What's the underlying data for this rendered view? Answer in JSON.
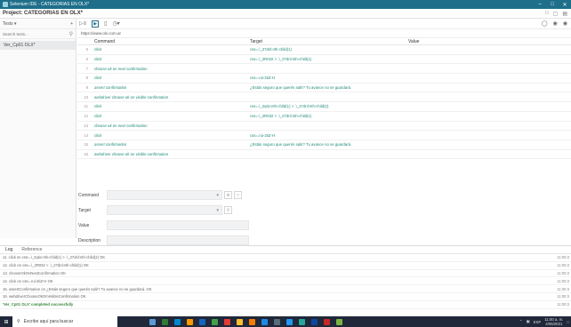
{
  "window": {
    "title": "Selenium IDE - CATEGORIAS EN OLX*"
  },
  "project": {
    "label": "Project:  CATEGORIAS EN OLX*"
  },
  "tests_panel": {
    "header": "Tests",
    "search_placeholder": "Search tests...",
    "items": [
      {
        "label": "Ver_Cp01 OLX*"
      }
    ]
  },
  "url": "https://www.olx.com.ar",
  "table": {
    "headers": {
      "command": "Command",
      "target": "Target",
      "value": "Value"
    },
    "rows": [
      {
        "num": "5",
        "command": "click",
        "target": "css=.\\_27dnl:nth-child(1)",
        "value": ""
      },
      {
        "num": "6",
        "command": "click",
        "target": "css=.\\_2R032 > .\\_27dnl:nth-child(1)",
        "value": ""
      },
      {
        "num": "7",
        "command": "choose ok on next confirmation",
        "target": "",
        "value": ""
      },
      {
        "num": "8",
        "command": "click",
        "target": "css=.rui-2tiZ-H",
        "value": ""
      },
      {
        "num": "9",
        "command": "assert confirmation",
        "target": "¿Estás seguro que querés salir? Tu avance no se guardará.",
        "value": ""
      },
      {
        "num": "10",
        "command": "webdriver choose ok on visible confirmation",
        "target": "",
        "value": ""
      },
      {
        "num": "11",
        "command": "click",
        "target": "css=.\\_2qIiv:nth-child(1) > .\\_27dnl:nth-child(2)",
        "value": ""
      },
      {
        "num": "12",
        "command": "click",
        "target": "css=.\\_2R032 > .\\_27dnl:nth-child(1)",
        "value": ""
      },
      {
        "num": "13",
        "command": "choose ok on next confirmation",
        "target": "",
        "value": ""
      },
      {
        "num": "14",
        "command": "click",
        "target": "css=.rui-2tiZ-H",
        "value": ""
      },
      {
        "num": "15",
        "command": "assert confirmation",
        "target": "¿Estás seguro que querés salir? Tu avance no se guardará.",
        "value": ""
      },
      {
        "num": "16",
        "command": "webdriver choose ok on visible confirmation",
        "target": "",
        "value": ""
      }
    ]
  },
  "form": {
    "command_label": "Command",
    "target_label": "Target",
    "value_label": "Value",
    "description_label": "Description"
  },
  "log": {
    "tabs": [
      "Log",
      "Reference"
    ],
    "lines": [
      {
        "text": "11. click on css=.\\_2qIiv:nth-child(1) > .\\_27dnl:nth-child(2) OK",
        "time": "11:00:3"
      },
      {
        "text": "12. click on css=.\\_2R032 > .\\_27dnl:nth-child(1) OK",
        "time": "11:00:3"
      },
      {
        "text": "13. chooseOkOnNextConfirmation OK",
        "time": "11:00:3"
      },
      {
        "text": "14. click on css=.rui-2tiZ-H OK",
        "time": "11:00:3"
      },
      {
        "text": "15. assertConfirmation on ¿Estás seguro que querés salir? Tu avance no se guardará. OK",
        "time": "11:00:3"
      },
      {
        "text": "16. webdriverChooseOkOnVisibleConfirmation OK",
        "time": "11:00:3"
      },
      {
        "text": "'Ver_Cp01 OLX' completed successfully",
        "time": "11:00:3",
        "success": true
      }
    ]
  },
  "taskbar": {
    "search_placeholder": "Escribe aquí para buscar",
    "lang": "ESP",
    "time": "11:00 a. m.",
    "date": "4/06/2021",
    "app_colors": [
      "#5b9bd5",
      "#2e7d32",
      "#0288d1",
      "#ff9800",
      "#1565c0",
      "#43a047",
      "#e53935",
      "#fbc02d",
      "#f57c00",
      "#1e88e5",
      "#546e7a",
      "#2196f3",
      "#26a69a",
      "#0d47a1",
      "#c62828",
      "#7cb342"
    ]
  },
  "colors": {
    "titlebar": "#1f6f8b",
    "command_text": "#1f8a78",
    "success": "#3c8a3c",
    "taskbar": "#20283a"
  }
}
